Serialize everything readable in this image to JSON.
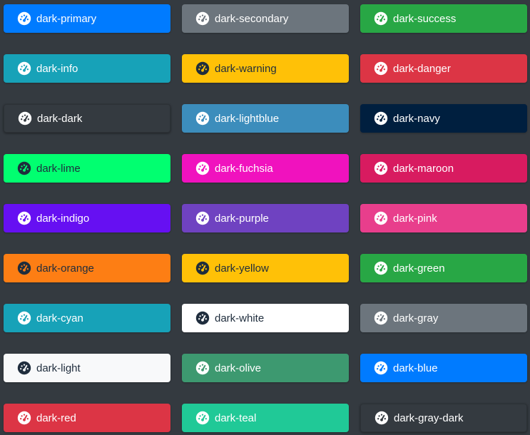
{
  "buttons": [
    {
      "label": "dark-primary",
      "bg": "#007bff",
      "fg": "#ffffff",
      "icon": "tachometer-icon"
    },
    {
      "label": "dark-secondary",
      "bg": "#6c757d",
      "fg": "#ffffff",
      "icon": "tachometer-icon"
    },
    {
      "label": "dark-success",
      "bg": "#28a745",
      "fg": "#ffffff",
      "icon": "tachometer-icon"
    },
    {
      "label": "dark-info",
      "bg": "#17a2b8",
      "fg": "#ffffff",
      "icon": "tachometer-icon"
    },
    {
      "label": "dark-warning",
      "bg": "#ffc107",
      "fg": "#1f2d3d",
      "icon": "tachometer-icon"
    },
    {
      "label": "dark-danger",
      "bg": "#dc3545",
      "fg": "#ffffff",
      "icon": "tachometer-icon"
    },
    {
      "label": "dark-dark",
      "bg": "#343a40",
      "fg": "#ffffff",
      "icon": "tachometer-icon"
    },
    {
      "label": "dark-lightblue",
      "bg": "#3c8dbc",
      "fg": "#ffffff",
      "icon": "tachometer-icon"
    },
    {
      "label": "dark-navy",
      "bg": "#001f3f",
      "fg": "#ffffff",
      "icon": "tachometer-icon"
    },
    {
      "label": "dark-lime",
      "bg": "#01ff70",
      "fg": "#1f2d3d",
      "icon": "tachometer-icon"
    },
    {
      "label": "dark-fuchsia",
      "bg": "#f012be",
      "fg": "#ffffff",
      "icon": "tachometer-icon"
    },
    {
      "label": "dark-maroon",
      "bg": "#d81b60",
      "fg": "#ffffff",
      "icon": "tachometer-icon"
    },
    {
      "label": "dark-indigo",
      "bg": "#6610f2",
      "fg": "#ffffff",
      "icon": "tachometer-icon"
    },
    {
      "label": "dark-purple",
      "bg": "#6f42c1",
      "fg": "#ffffff",
      "icon": "tachometer-icon"
    },
    {
      "label": "dark-pink",
      "bg": "#e83e8c",
      "fg": "#ffffff",
      "icon": "tachometer-icon"
    },
    {
      "label": "dark-orange",
      "bg": "#fd7e14",
      "fg": "#1f2d3d",
      "icon": "tachometer-icon"
    },
    {
      "label": "dark-yellow",
      "bg": "#ffc107",
      "fg": "#1f2d3d",
      "icon": "tachometer-icon"
    },
    {
      "label": "dark-green",
      "bg": "#28a745",
      "fg": "#ffffff",
      "icon": "tachometer-icon"
    },
    {
      "label": "dark-cyan",
      "bg": "#17a2b8",
      "fg": "#ffffff",
      "icon": "tachometer-icon"
    },
    {
      "label": "dark-white",
      "bg": "#ffffff",
      "fg": "#1f2d3d",
      "icon": "tachometer-icon"
    },
    {
      "label": "dark-gray",
      "bg": "#6c757d",
      "fg": "#ffffff",
      "icon": "tachometer-icon"
    },
    {
      "label": "dark-light",
      "bg": "#f8f9fa",
      "fg": "#1f2d3d",
      "icon": "tachometer-icon"
    },
    {
      "label": "dark-olive",
      "bg": "#3d9970",
      "fg": "#ffffff",
      "icon": "tachometer-icon"
    },
    {
      "label": "dark-blue",
      "bg": "#007bff",
      "fg": "#ffffff",
      "icon": "tachometer-icon"
    },
    {
      "label": "dark-red",
      "bg": "#dc3545",
      "fg": "#ffffff",
      "icon": "tachometer-icon"
    },
    {
      "label": "dark-teal",
      "bg": "#20c997",
      "fg": "#ffffff",
      "icon": "tachometer-icon"
    },
    {
      "label": "dark-gray-dark",
      "bg": "#343a40",
      "fg": "#ffffff",
      "icon": "tachometer-icon"
    }
  ]
}
